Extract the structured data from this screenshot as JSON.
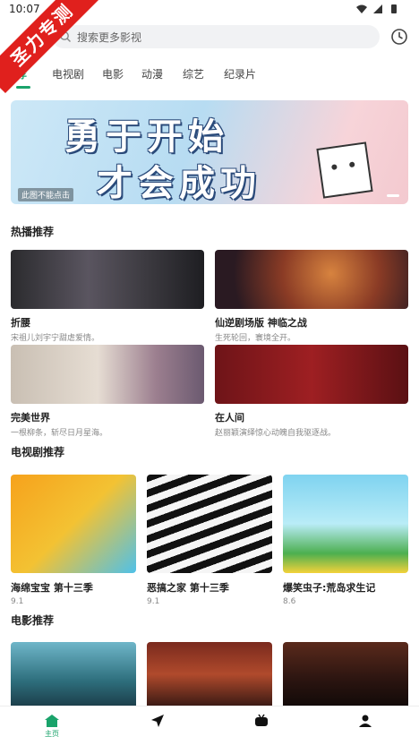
{
  "status": {
    "time": "10:07"
  },
  "watermark": "圣力专测",
  "search": {
    "placeholder": "搜索更多影视"
  },
  "tabs": [
    {
      "label": "荐"
    },
    {
      "label": "电视剧"
    },
    {
      "label": "电影"
    },
    {
      "label": "动漫"
    },
    {
      "label": "综艺"
    },
    {
      "label": "纪录片"
    }
  ],
  "banner": {
    "line1": "勇于开始",
    "line2": "才会成功",
    "badge": "此图不能点击"
  },
  "sections": {
    "hot": "热播推荐",
    "tv": "电视剧推荐",
    "movie": "电影推荐"
  },
  "hot_items": [
    {
      "name": "折腰",
      "desc": "宋祖儿刘宇宁甜虐爱情。"
    },
    {
      "name": "仙逆剧场版 神临之战",
      "desc": "生死轮回，寰境全开。"
    },
    {
      "name": "完美世界",
      "desc": "一根柳条，斩尽日月星海。"
    },
    {
      "name": "在人间",
      "desc": "赵丽颖演绎惊心动魄自我驱逐战。"
    }
  ],
  "tv_items": [
    {
      "name": "海绵宝宝 第十三季",
      "score": "9.1"
    },
    {
      "name": "恶搞之家 第十三季",
      "score": "9.1"
    },
    {
      "name": "爆笑虫子:荒岛求生记",
      "score": "8.6"
    }
  ],
  "bottom_nav": {
    "home_label": "主页"
  },
  "colors": {
    "accent": "#1aa36b",
    "watermark": "#e0201d"
  }
}
